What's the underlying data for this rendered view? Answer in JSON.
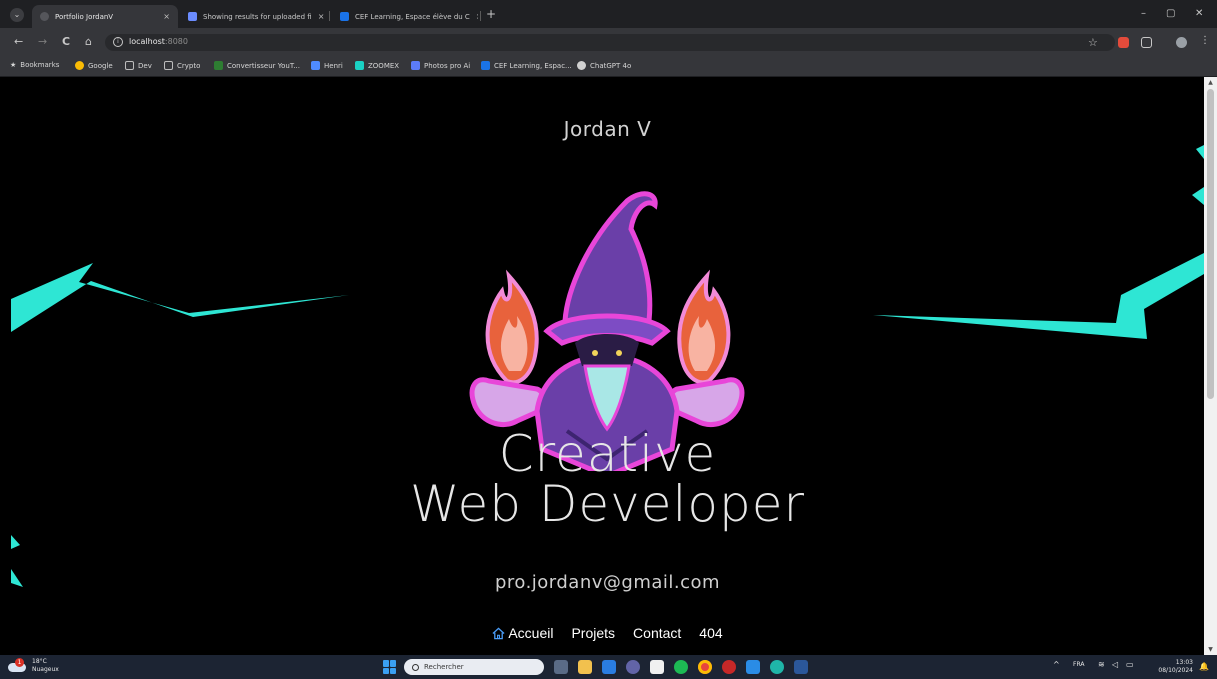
{
  "browser": {
    "tabs": [
      {
        "title": "Portfolio JordanV",
        "active": true,
        "favicon_color": "#3a3b3f"
      },
      {
        "title": "Showing results for uploaded fi",
        "active": false,
        "favicon_color": "#6b8cff"
      },
      {
        "title": "CEF Learning, Espace élève du C",
        "active": false,
        "favicon_color": "#1a73e8"
      }
    ],
    "close_glyph": "×",
    "new_tab_glyph": "+",
    "window_controls": {
      "minimize": "–",
      "restore": "▢",
      "close": "✕"
    },
    "nav": {
      "back": "←",
      "forward": "→",
      "reload": "C",
      "home": "⌂"
    },
    "url": {
      "host": "localhost",
      "port": ":8080"
    },
    "bookmarks": [
      {
        "label": "Bookmarks",
        "color": "#d6d6d6"
      },
      {
        "label": "Google",
        "color": "#fbbc05"
      },
      {
        "label": "Dev",
        "color": "#9a9a9a"
      },
      {
        "label": "Crypto",
        "color": "#9a9a9a"
      },
      {
        "label": "Convertisseur YouT...",
        "color": "#2e7d32"
      },
      {
        "label": "Henri",
        "color": "#4f8cff"
      },
      {
        "label": "ZOOMEX",
        "color": "#1ad1c3"
      },
      {
        "label": "Photos pro Ai",
        "color": "#5c7cfa"
      },
      {
        "label": "CEF Learning, Espac...",
        "color": "#1a73e8"
      },
      {
        "label": "ChatGPT 4o",
        "color": "#d0d0d0"
      }
    ]
  },
  "page": {
    "site_name": "Jordan V",
    "headline_line1": "Creative",
    "headline_line2": "Web Developer",
    "email": "pro.jordanv@gmail.com",
    "nav": [
      {
        "label": "Accueil",
        "icon": "home-icon",
        "active": true
      },
      {
        "label": "Projets"
      },
      {
        "label": "Contact"
      },
      {
        "label": "404"
      }
    ],
    "accent_color": "#2ee6d4",
    "home_icon_color": "#4a9df8"
  },
  "taskbar": {
    "weather_temp": "18°C",
    "weather_desc": "Nuageux",
    "weather_badge": "1",
    "search_placeholder": "Rechercher",
    "language": "FRA",
    "time": "13:03",
    "date": "08/10/2024"
  }
}
